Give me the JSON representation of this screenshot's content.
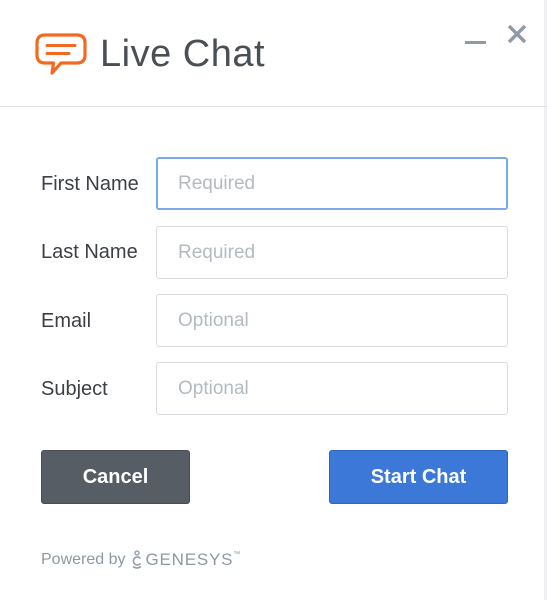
{
  "header": {
    "title": "Live Chat",
    "icon": "chat-bubble-icon",
    "minimize_icon": "minimize-icon",
    "close_icon": "close-icon"
  },
  "form": {
    "first_name": {
      "label": "First Name",
      "placeholder": "Required",
      "value": ""
    },
    "last_name": {
      "label": "Last Name",
      "placeholder": "Required",
      "value": ""
    },
    "email": {
      "label": "Email",
      "placeholder": "Optional",
      "value": ""
    },
    "subject": {
      "label": "Subject",
      "placeholder": "Optional",
      "value": ""
    }
  },
  "actions": {
    "cancel_label": "Cancel",
    "start_label": "Start Chat"
  },
  "footer": {
    "powered_by": "Powered by",
    "brand": "GENESYS",
    "trademark": "™"
  },
  "colors": {
    "brand_orange": "#f26a21",
    "primary_blue": "#3c78d8",
    "cancel_gray": "#565d64",
    "focus_border": "#7da9e6"
  }
}
